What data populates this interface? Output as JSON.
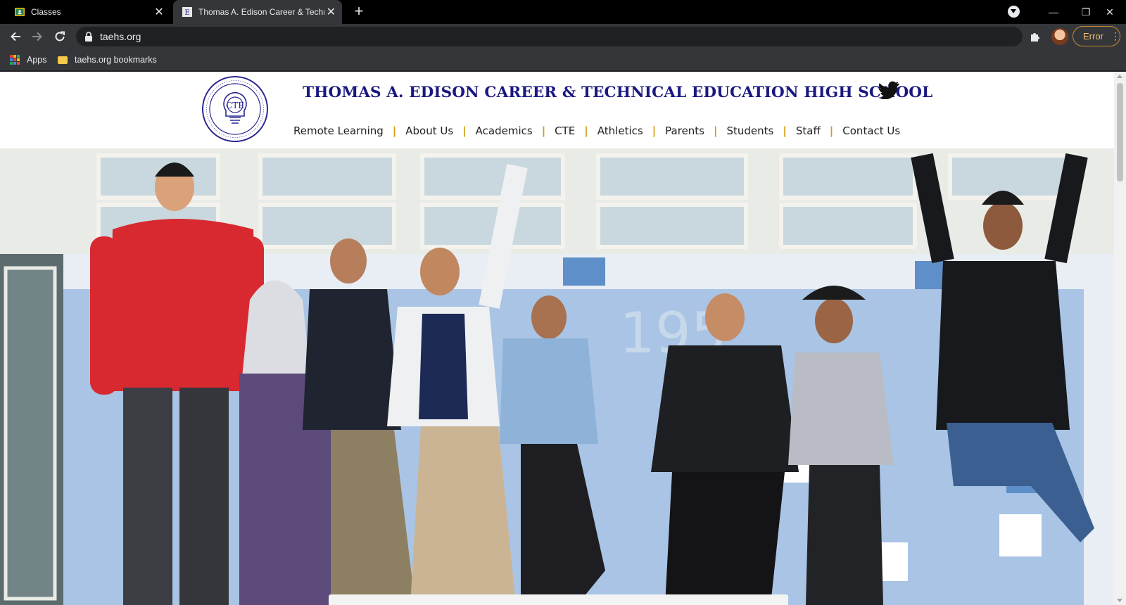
{
  "browser": {
    "tabs": [
      {
        "title": "Classes",
        "active": false,
        "favicon": "google-classroom-icon"
      },
      {
        "title": "Thomas A. Edison Career & Techn",
        "active": true,
        "favicon": "taehs-favicon"
      }
    ],
    "url": "taehs.org",
    "error_label": "Error",
    "bookmarks": [
      {
        "label": "Apps",
        "icon": "apps-grid-icon"
      },
      {
        "label": "taehs.org bookmarks",
        "icon": "folder-icon"
      }
    ]
  },
  "site": {
    "school_name": "THOMAS A. EDISON CAREER & TECHNICAL EDUCATION HIGH SCHOOL",
    "nav": [
      "Remote Learning",
      "About Us",
      "Academics",
      "CTE",
      "Athletics",
      "Parents",
      "Students",
      "Staff",
      "Contact Us"
    ],
    "nav_separator": "|",
    "seal_text": "CTE",
    "hero_image": "students-jumping-photo"
  },
  "colors": {
    "brand_navy": "#1a1880",
    "nav_separator": "#d49c12",
    "error_chip": "#f6c06d"
  }
}
